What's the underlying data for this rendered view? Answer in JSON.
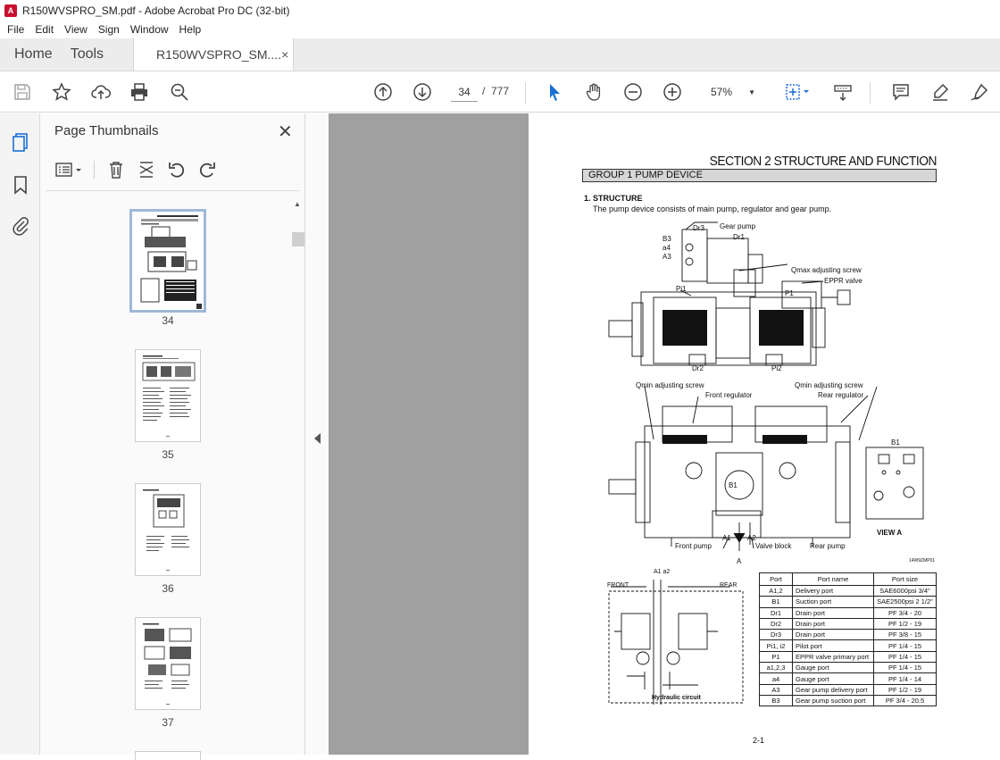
{
  "window": {
    "title": "R150WVSPRO_SM.pdf - Adobe Acrobat Pro DC (32-bit)"
  },
  "menu": [
    "File",
    "Edit",
    "View",
    "Sign",
    "Window",
    "Help"
  ],
  "tabs": {
    "home": "Home",
    "tools": "Tools",
    "document": "R150WVSPRO_SM....",
    "close": "×"
  },
  "toolbar": {
    "page_current": "34",
    "page_sep": "/",
    "page_total": "777",
    "zoom": "57%"
  },
  "thumbnails": {
    "title": "Page Thumbnails",
    "close": "✕",
    "pages": [
      "34",
      "35",
      "36",
      "37"
    ]
  },
  "page": {
    "section": "SECTION  2  STRUCTURE AND FUNCTION",
    "group": "GROUP  1  PUMP DEVICE",
    "heading": "1. STRUCTURE",
    "body": "The pump device consists of main pump, regulator and gear pump.",
    "labels": {
      "gear_pump": "Gear pump",
      "dr3": "Dr3",
      "dr1": "Dr1",
      "b3": "B3",
      "a4": "a4",
      "a3": "A3",
      "qmax": "Qmax adjusting screw",
      "eppr": "EPPR valve",
      "pi1": "Pi1",
      "p1": "P1",
      "dr2": "Dr2",
      "pi2": "Pi2",
      "qmin_left": "Qmin adjusting screw",
      "front_reg": "Front regulator",
      "qmin_right": "Qmin adjusting screw",
      "rear_reg": "Rear regulator",
      "b1": "B1",
      "a1": "A1",
      "a2": "A2",
      "a": "A",
      "front_pump": "Front pump",
      "valve_block": "Valve block",
      "rear_pump": "Rear pump",
      "view_a": "VIEW  A",
      "b1_view": "B1",
      "fig_code": "14W9ZMP01",
      "front": "FRONT",
      "rear": "REAR",
      "a1a2": "A1  a2",
      "hyd": "Hydraulic circuit"
    },
    "table": {
      "headers": [
        "Port",
        "Port name",
        "Port size"
      ],
      "rows": [
        [
          "A1,2",
          "Delivery port",
          "SAE6000psi 3/4\""
        ],
        [
          "B1",
          "Suction port",
          "SAE2500psi 2 1/2\""
        ],
        [
          "Dr1",
          "Drain port",
          "PF 3/4 - 20"
        ],
        [
          "Dr2",
          "Drain port",
          "PF 1/2 - 19"
        ],
        [
          "Dr3",
          "Drain port",
          "PF 3/8 - 15"
        ],
        [
          "Pi1, i2",
          "Pilot port",
          "PF 1/4 - 15"
        ],
        [
          "P1",
          "EPPR valve primary port",
          "PF 1/4 - 15"
        ],
        [
          "a1,2,3",
          "Gauge port",
          "PF 1/4 - 15"
        ],
        [
          "a4",
          "Gauge port",
          "PF 1/4 - 14"
        ],
        [
          "A3",
          "Gear pump delivery port",
          "PF 1/2 - 19"
        ],
        [
          "B3",
          "Gear pump suction port",
          "PF 3/4 - 20.5"
        ]
      ]
    },
    "footer": "2-1"
  }
}
